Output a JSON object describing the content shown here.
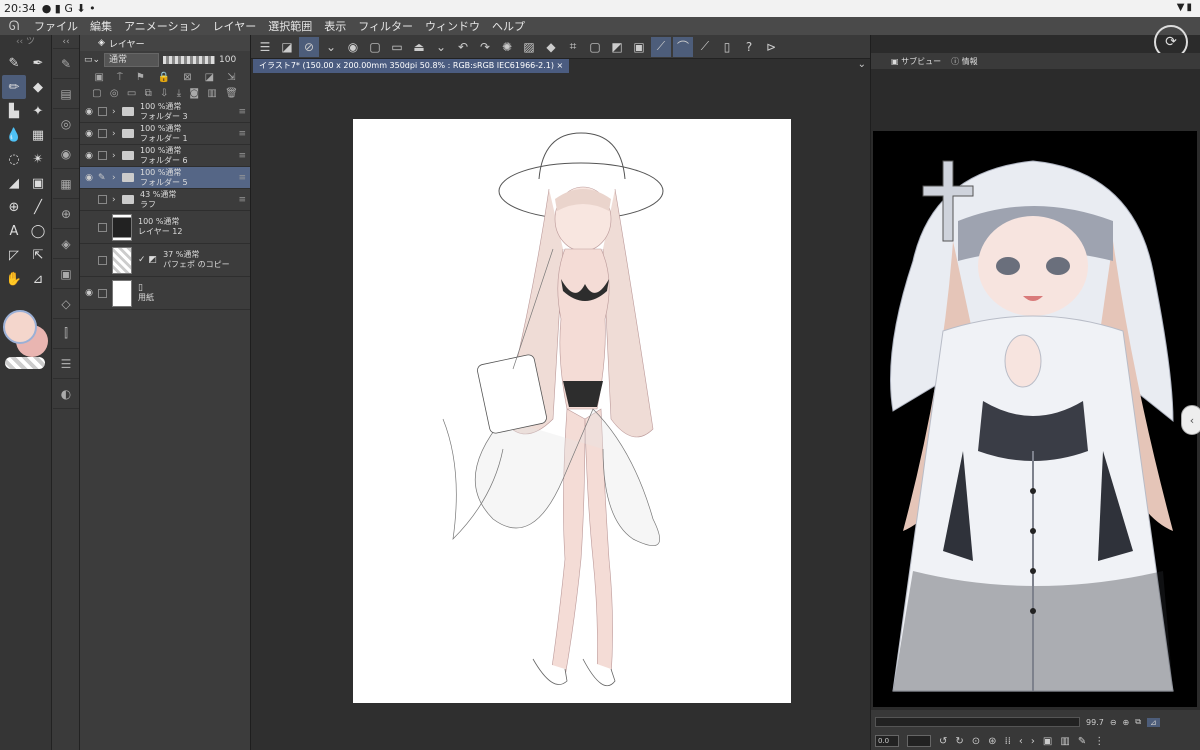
{
  "status_bar": {
    "time": "20:34",
    "icons": "● ▮ G ⬇ •",
    "right_icons": "▼▮"
  },
  "menu": {
    "items": [
      "ファイル",
      "編集",
      "アニメーション",
      "レイヤー",
      "選択範囲",
      "表示",
      "フィルター",
      "ウィンドウ",
      "ヘルプ"
    ]
  },
  "tools": {
    "header": "ツ"
  },
  "layer_panel": {
    "tab_label": "レイヤー",
    "blend_mode": "通常",
    "opacity": "100",
    "layers": [
      {
        "line1": "100 %通常",
        "line2": "フォルダー 3",
        "type": "folder",
        "visible": true,
        "selected": false
      },
      {
        "line1": "100 %通常",
        "line2": "フォルダー 1",
        "type": "folder",
        "visible": true,
        "selected": false
      },
      {
        "line1": "100 %通常",
        "line2": "フォルダー 6",
        "type": "folder",
        "visible": true,
        "selected": false
      },
      {
        "line1": "100 %通常",
        "line2": "フォルダー 5",
        "type": "folder",
        "visible": true,
        "selected": true
      },
      {
        "line1": "43 %通常",
        "line2": "ラフ",
        "type": "folder",
        "visible": false,
        "selected": false
      },
      {
        "line1": "100 %通常",
        "line2": "レイヤー 12",
        "type": "raster",
        "visible": false,
        "selected": false
      },
      {
        "line1": "37 %通常",
        "line2": "パフェポ のコピー",
        "type": "raster",
        "visible": false,
        "selected": false
      },
      {
        "line1": "",
        "line2": "用紙",
        "type": "paper",
        "visible": true,
        "selected": false
      }
    ]
  },
  "document": {
    "tab_title": "イラスト7* (150.00 x 200.00mm 350dpi 50.8% : RGB:sRGB IEC61966-2.1)"
  },
  "sub_view": {
    "tab_label": "サブビュー",
    "info_label": "情報",
    "zoom": "99.7",
    "angle": "0.0"
  },
  "colors": {
    "main": "#f4d6cc",
    "sub": "#e9b5b1",
    "selection": "#556686",
    "accent": "#4b5c80"
  }
}
